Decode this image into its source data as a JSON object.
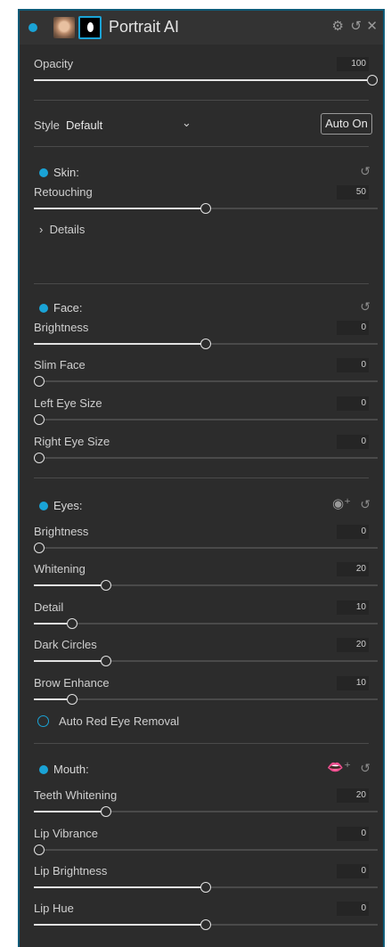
{
  "header": {
    "title": "Portrait AI",
    "settings_icon": "gear-icon",
    "reset_icon": "reset-icon",
    "close_icon": "close-icon"
  },
  "opacity": {
    "label": "Opacity",
    "value": "100",
    "fraction": 1.0
  },
  "style": {
    "label": "Style",
    "value": "Default",
    "auto_button": "Auto On"
  },
  "skin": {
    "title": "Skin:",
    "retouching": {
      "label": "Retouching",
      "value": "50",
      "fraction": 0.5
    },
    "details_label": "Details"
  },
  "face": {
    "title": "Face:",
    "brightness": {
      "label": "Brightness",
      "value": "0",
      "fraction": 0.5
    },
    "slim_face": {
      "label": "Slim Face",
      "value": "0",
      "fraction": 0.0
    },
    "left_eye": {
      "label": "Left Eye Size",
      "value": "0",
      "fraction": 0.0
    },
    "right_eye": {
      "label": "Right Eye Size",
      "value": "0",
      "fraction": 0.0
    }
  },
  "eyes": {
    "title": "Eyes:",
    "brightness": {
      "label": "Brightness",
      "value": "0",
      "fraction": 0.0
    },
    "whitening": {
      "label": "Whitening",
      "value": "20",
      "fraction": 0.2
    },
    "detail": {
      "label": "Detail",
      "value": "10",
      "fraction": 0.1
    },
    "dark_circles": {
      "label": "Dark Circles",
      "value": "20",
      "fraction": 0.2
    },
    "brow_enhance": {
      "label": "Brow Enhance",
      "value": "10",
      "fraction": 0.1
    },
    "red_eye_label": "Auto Red Eye Removal"
  },
  "mouth": {
    "title": "Mouth:",
    "teeth_whitening": {
      "label": "Teeth Whitening",
      "value": "20",
      "fraction": 0.2
    },
    "lip_vibrance": {
      "label": "Lip Vibrance",
      "value": "0",
      "fraction": 0.0
    },
    "lip_brightness": {
      "label": "Lip Brightness",
      "value": "0",
      "fraction": 0.5
    },
    "lip_hue": {
      "label": "Lip Hue",
      "value": "0",
      "fraction": 0.5
    }
  },
  "colors": {
    "accent": "#1aa3d6",
    "panel": "#2c2c2c"
  }
}
